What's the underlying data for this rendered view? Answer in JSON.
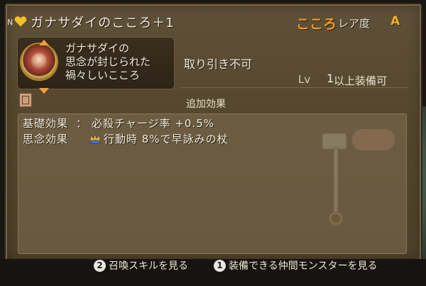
{
  "header": {
    "rank_badge": "N",
    "title": "ガナサダイのこころ＋1",
    "category_label": "こころ",
    "rarity_label": "レア度",
    "rarity_value": "A"
  },
  "card": {
    "description_lines": [
      "ガナサダイの",
      "思念が封じられた",
      "禍々しいこころ"
    ]
  },
  "trade_status": "取り引き不可",
  "level": {
    "label": "Lv",
    "value": "1",
    "suffix": "以上装備可"
  },
  "effects": {
    "section_title": "追加効果",
    "rows": [
      {
        "name": "基礎効果",
        "separator": "：",
        "value": "必殺チャージ率 +0.5%"
      },
      {
        "name": "思念効果",
        "icon": "crown-icon",
        "value": "行動時 8%で早詠みの杖"
      }
    ]
  },
  "footer": {
    "hint_1_button": "2",
    "hint_1_label": "召喚スキルを見る",
    "hint_2_button": "1",
    "hint_2_label": "装備できる仲間モンスターを見る"
  },
  "colors": {
    "accent_orange": "#f09a2a",
    "rarity_gold": "#f0b02a",
    "panel_brown": "#56482f"
  }
}
